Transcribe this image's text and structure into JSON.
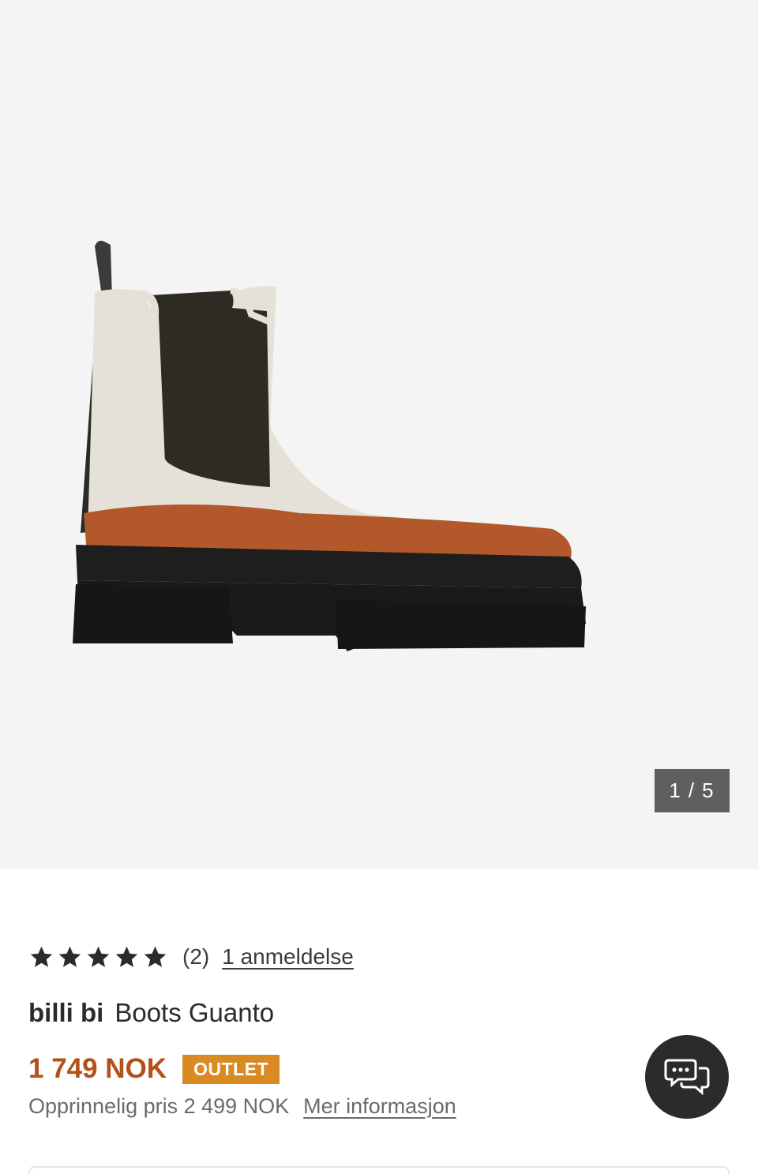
{
  "gallery": {
    "current": "1",
    "separator": "/",
    "total": "5",
    "image_icon": "boot-product-image"
  },
  "rating": {
    "stars": 5,
    "count": "(2)",
    "reviews_link": "1 anmeldelse"
  },
  "product": {
    "brand": "billi bi",
    "name": "Boots Guanto"
  },
  "pricing": {
    "price": "1 749 NOK",
    "badge": "OUTLET",
    "original_text": "Opprinnelig pris 2 499 NOK",
    "more_info": "Mer informasjon"
  },
  "chat": {
    "icon": "chat-bubbles-icon"
  },
  "colors": {
    "price": "#b4501a",
    "badge": "#d98a22",
    "text": "#2b2b2b",
    "gallery_bg": "#f4f4f4"
  }
}
